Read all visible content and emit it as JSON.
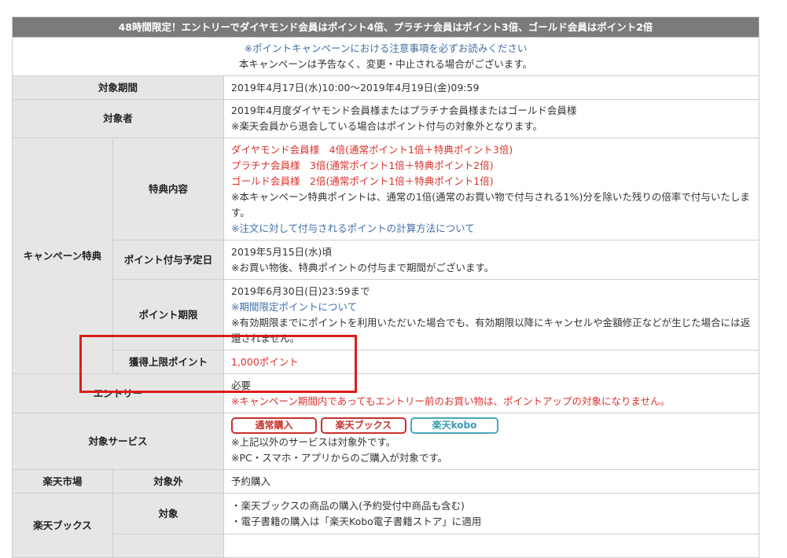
{
  "title": "48時間限定！エントリーでダイヤモンド会員はポイント4倍、プラチナ会員はポイント3倍、ゴールド会員はポイント2倍",
  "notice": {
    "link": "※ポイントキャンペーンにおける注意事項を必ずお読みください",
    "text": "本キャンペーンは予告なく、変更・中止される場合がございます。"
  },
  "period": {
    "label": "対象期間",
    "value": "2019年4月17日(水)10:00～2019年4月19日(金)09:59"
  },
  "target": {
    "label": "対象者",
    "line1": "2019年4月度ダイヤモンド会員様またはプラチナ会員様またはゴールド会員様",
    "line2": "※楽天会員から退会している場合はポイント付与の対象外となります。"
  },
  "campaign": {
    "label": "キャンペーン特典",
    "benefit": {
      "label": "特典内容",
      "diamond": "ダイヤモンド会員様　4倍(通常ポイント1倍＋特典ポイント3倍)",
      "platinum": "プラチナ会員様　3倍(通常ポイント1倍＋特典ポイント2倍)",
      "gold": "ゴールド会員様　2倍(通常ポイント1倍＋特典ポイント1倍)",
      "note": "※本キャンペーン特典ポイントは、通常の1倍(通常のお買い物で付与される1%)分を除いた残りの倍率で付与いたします。",
      "link": "※注文に対して付与されるポイントの計算方法について"
    },
    "grant": {
      "label": "ポイント付与予定日",
      "date": "2019年5月15日(水)頃",
      "note": "※お買い物後、特典ポイントの付与まで期間がございます。"
    },
    "expiry": {
      "label": "ポイント期限",
      "date": "2019年6月30日(日)23:59まで",
      "link": "※期間限定ポイントについて",
      "note": "※有効期限までにポイントを利用いただいた場合でも、有効期限以降にキャンセルや金額修正などが生じた場合には返還されません。"
    },
    "limit": {
      "label": "獲得上限ポイント",
      "value": "1,000ポイント"
    }
  },
  "entry": {
    "label": "エントリー",
    "value": "必要",
    "note": "※キャンペーン期間内であってもエントリー前のお買い物は、ポイントアップの対象になりません。"
  },
  "services": {
    "label": "対象サービス",
    "badges": [
      "通常購入",
      "楽天ブックス",
      "楽天kobo"
    ],
    "note1": "※上記以外のサービスは対象外です。",
    "note2": "※PC・スマホ・アプリからのご購入が対象です。"
  },
  "ichiba": {
    "label": "楽天市場",
    "sub": "対象外",
    "value": "予約購入"
  },
  "books": {
    "label": "楽天ブックス",
    "sub": "対象",
    "line1": "・楽天ブックスの商品の購入(予約受付中商品も含む)",
    "line2": "・電子書籍の購入は「楽天Kobo電子書籍ストア」に適用"
  },
  "colors": {
    "header_bg": "#7b7b7b",
    "label_bg": "#e6e6e6",
    "red": "#d9322e",
    "link_blue": "#3f6fa6",
    "highlight": "#dd1b1b"
  }
}
